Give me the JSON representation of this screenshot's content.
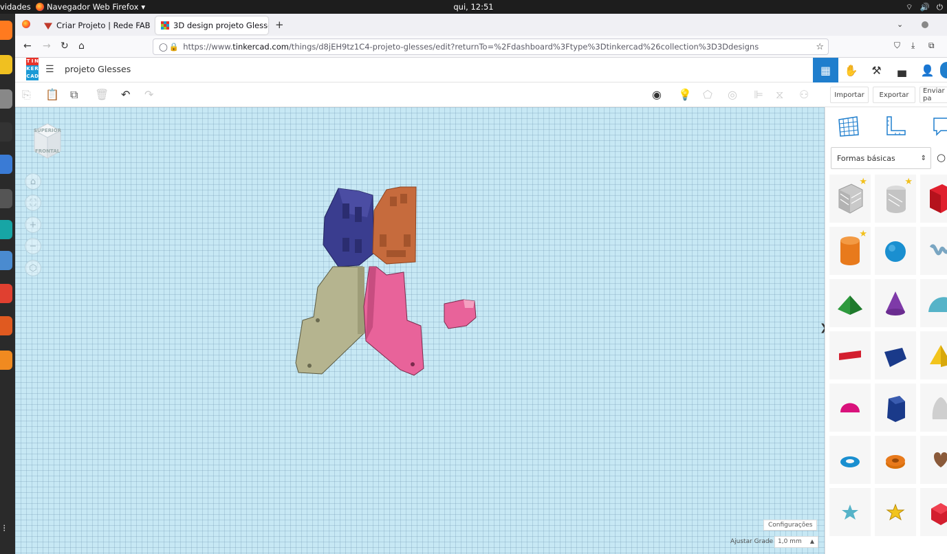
{
  "os": {
    "activities": "vidades",
    "app_name": "Navegador Web Firefox",
    "clock": "qui, 12:51"
  },
  "browser": {
    "tabs": [
      {
        "title": "Criar Projeto | Rede FAB",
        "active": false
      },
      {
        "title": "3D design projeto Glesse",
        "active": true
      }
    ],
    "url_prefix": "https://www.",
    "url_host": "tinkercad.com",
    "url_path": "/things/d8jEH9tz1C4-projeto-glesses/edit?returnTo=%2Fdashboard%3Ftype%3Dtinkercad%26collection%3D3Ddesigns"
  },
  "tinkercad": {
    "logo_letters": [
      "T",
      "I",
      "N",
      "K",
      "E",
      "R",
      "C",
      "A",
      "D"
    ],
    "project_title": "projeto Glesses",
    "toolbar": {
      "import_label": "Importar",
      "export_label": "Exportar",
      "send_label": "Enviar pa"
    },
    "viewcube": {
      "top": "SUPERIOR",
      "front": "FRONTAL"
    },
    "workplane": {
      "settings_label": "Configurações",
      "grid_label": "Ajustar Grade",
      "grid_value": "1,0 mm"
    },
    "shapes_panel": {
      "category": "Formas básicas",
      "shapes": [
        "box-hole",
        "cylinder-hole",
        "box",
        "cylinder",
        "sphere",
        "scribble",
        "roof",
        "cone",
        "round-roof",
        "text",
        "wedge",
        "pyramid",
        "half-sphere",
        "polygon",
        "paraboloid",
        "torus",
        "tube",
        "heart",
        "star",
        "star-gold",
        "icosahedron"
      ]
    }
  },
  "colors": {
    "selected_view": "#1f7ecd",
    "workplane": "#c7e8f4",
    "part_blue": "#3a3d8f",
    "part_orange": "#c66b3d",
    "part_khaki": "#b5b48f",
    "part_pink": "#e8639a"
  }
}
